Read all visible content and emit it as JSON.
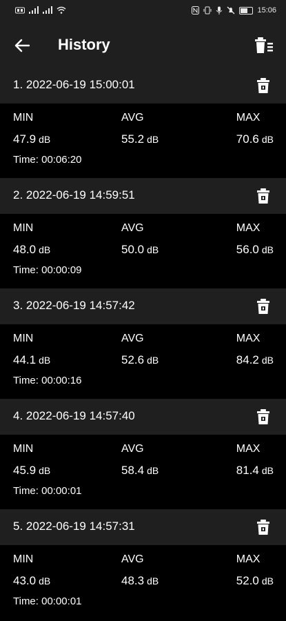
{
  "status_bar": {
    "time": "15:06",
    "left_icons": [
      "sim-icon",
      "signal-icon",
      "signal-icon",
      "wifi-icon"
    ],
    "right_icons": [
      "nfc-icon",
      "vibrate-icon",
      "mic-icon",
      "mute-icon",
      "battery-icon"
    ]
  },
  "header": {
    "title": "History",
    "back_icon": "arrow-left-icon",
    "clear_icon": "delete-all-icon"
  },
  "labels": {
    "min": "MIN",
    "avg": "AVG",
    "max": "MAX",
    "unit": "dB"
  },
  "records": [
    {
      "title": "1. 2022-06-19 15:00:01",
      "min": "47.9",
      "avg": "55.2",
      "max": "70.6",
      "time": "Time: 00:06:20"
    },
    {
      "title": "2. 2022-06-19 14:59:51",
      "min": "48.0",
      "avg": "50.0",
      "max": "56.0",
      "time": "Time: 00:00:09"
    },
    {
      "title": "3. 2022-06-19 14:57:42",
      "min": "44.1",
      "avg": "52.6",
      "max": "84.2",
      "time": "Time: 00:00:16"
    },
    {
      "title": "4. 2022-06-19 14:57:40",
      "min": "45.9",
      "avg": "58.4",
      "max": "81.4",
      "time": "Time: 00:00:01"
    },
    {
      "title": "5. 2022-06-19 14:57:31",
      "min": "43.0",
      "avg": "48.3",
      "max": "52.0",
      "time": "Time: 00:00:01"
    }
  ]
}
